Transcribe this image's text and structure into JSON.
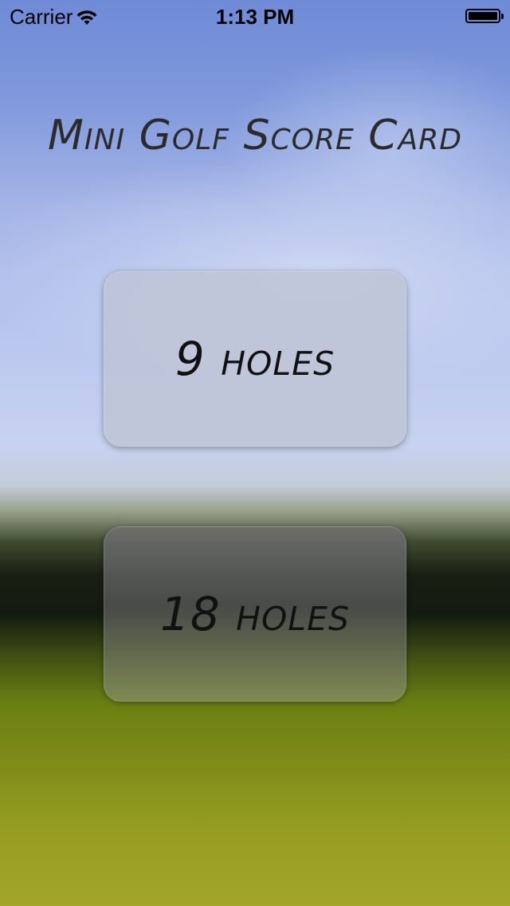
{
  "status_bar": {
    "carrier": "Carrier",
    "time": "1:13 PM",
    "wifi_icon": "wifi-icon",
    "battery_icon": "battery-icon"
  },
  "title": "Mini Golf Score Card",
  "buttons": {
    "nine_holes": "9 holes",
    "eighteen_holes": "18 holes"
  },
  "colors": {
    "sky": "#7f98dc",
    "grass": "#8f9a1e",
    "text": "#2b2b2b"
  }
}
